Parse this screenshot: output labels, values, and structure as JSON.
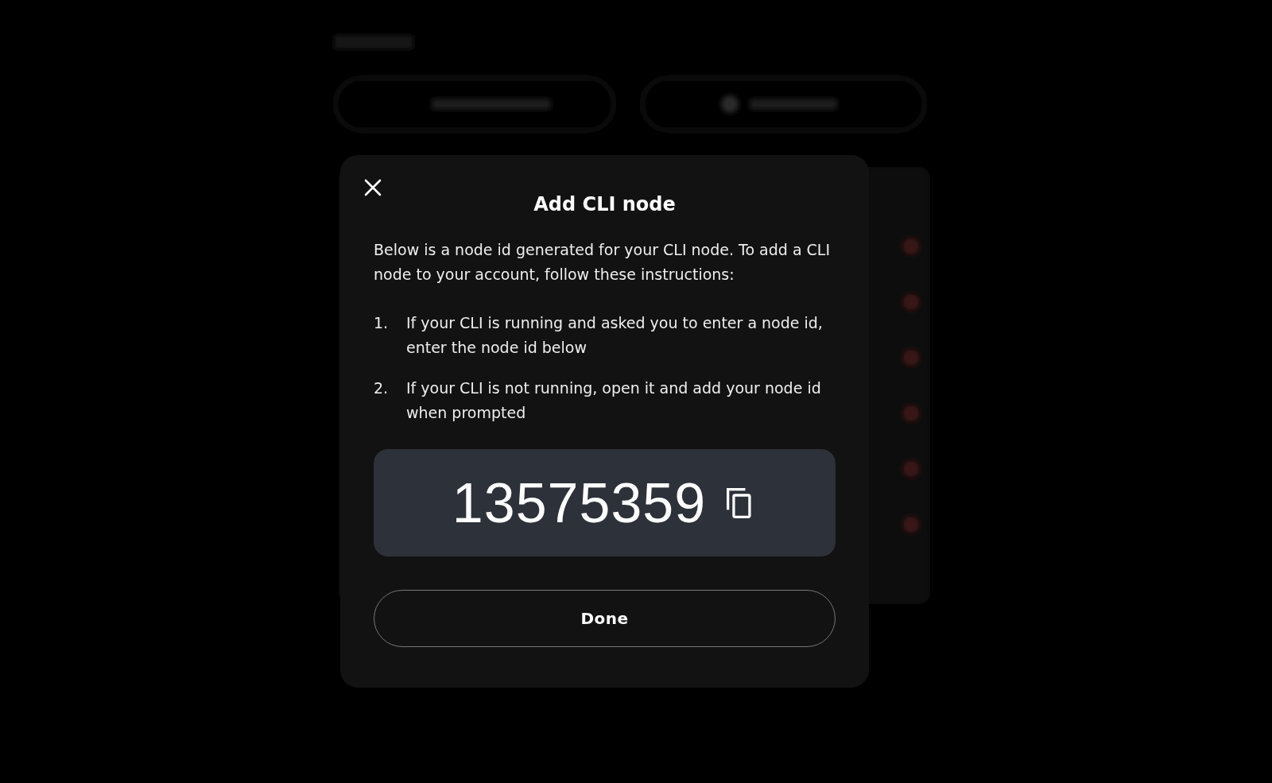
{
  "dialog": {
    "title": "Add CLI node",
    "intro": "Below is a node id generated for your CLI node. To add a CLI node to your account, follow these instructions:",
    "steps": [
      {
        "number": "1.",
        "text": "If your CLI is running and asked you to enter a node id, enter the node id below"
      },
      {
        "number": "2.",
        "text": "If your CLI is not running, open it and add your node id when prompted"
      }
    ],
    "node_id": "13575359",
    "done_button": "Done"
  }
}
